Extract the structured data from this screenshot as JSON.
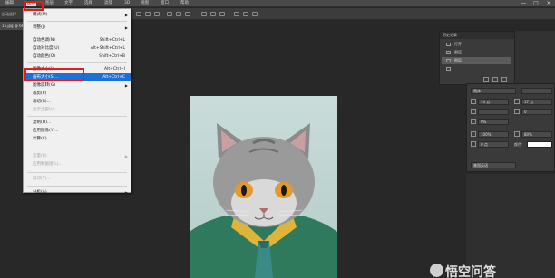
{
  "menubar": {
    "items": [
      "编辑",
      "图像",
      "图层",
      "文字",
      "选择",
      "滤镜",
      "3D",
      "视图",
      "窗口",
      "帮助"
    ],
    "active_index": 1,
    "window_controls": [
      "—",
      "□",
      "×"
    ]
  },
  "options": {
    "label": "自动选择"
  },
  "document_tab": {
    "title": "15.jpg @ 66.7%"
  },
  "image_menu": {
    "items": [
      {
        "label": "模式(M)",
        "shortcut": "",
        "submenu": true,
        "disabled": false,
        "highlight": false
      },
      {
        "label": "调整(J)",
        "shortcut": "",
        "submenu": true,
        "disabled": false,
        "highlight": false
      },
      {
        "label": "自动色调(N)",
        "shortcut": "Shift+Ctrl+L",
        "submenu": false,
        "disabled": false,
        "highlight": false
      },
      {
        "label": "自动对比度(U)",
        "shortcut": "Alt+Shift+Ctrl+L",
        "submenu": false,
        "disabled": false,
        "highlight": false
      },
      {
        "label": "自动颜色(O)",
        "shortcut": "Shift+Ctrl+B",
        "submenu": false,
        "disabled": false,
        "highlight": false
      },
      {
        "label": "图像大小(I)...",
        "shortcut": "Alt+Ctrl+I",
        "submenu": false,
        "disabled": false,
        "highlight": false
      },
      {
        "label": "画布大小(S)...",
        "shortcut": "Alt+Ctrl+C",
        "submenu": false,
        "disabled": false,
        "highlight": true
      },
      {
        "label": "图像旋转(G)",
        "shortcut": "",
        "submenu": true,
        "disabled": false,
        "highlight": false
      },
      {
        "label": "裁剪(P)",
        "shortcut": "",
        "submenu": false,
        "disabled": false,
        "highlight": false
      },
      {
        "label": "裁切(R)...",
        "shortcut": "",
        "submenu": false,
        "disabled": false,
        "highlight": false
      },
      {
        "label": "显示全部(V)",
        "shortcut": "",
        "submenu": false,
        "disabled": true,
        "highlight": false
      },
      {
        "label": "复制(D)...",
        "shortcut": "",
        "submenu": false,
        "disabled": false,
        "highlight": false
      },
      {
        "label": "应用图像(Y)...",
        "shortcut": "",
        "submenu": false,
        "disabled": false,
        "highlight": false
      },
      {
        "label": "计算(C)...",
        "shortcut": "",
        "submenu": false,
        "disabled": false,
        "highlight": false
      },
      {
        "label": "变量(B)",
        "shortcut": "",
        "submenu": true,
        "disabled": true,
        "highlight": false
      },
      {
        "label": "应用数据组(L)...",
        "shortcut": "",
        "submenu": false,
        "disabled": true,
        "highlight": false
      },
      {
        "label": "陷印(T)...",
        "shortcut": "",
        "submenu": false,
        "disabled": true,
        "highlight": false
      },
      {
        "label": "分析(A)",
        "shortcut": "",
        "submenu": true,
        "disabled": false,
        "highlight": false
      }
    ]
  },
  "history_panel": {
    "title": "历史记录",
    "rows": [
      {
        "label": "打开",
        "selected": false
      },
      {
        "label": "图层",
        "selected": false
      },
      {
        "label": "图层",
        "selected": true
      },
      {
        "label": "",
        "selected": false
      }
    ]
  },
  "character_panel": {
    "font": "黑体",
    "size": "14 点",
    "leading": "17 点",
    "tracking": "0",
    "scale_pct": "0%",
    "vscale": "100%",
    "hscale": "80%",
    "baseline": "0 点",
    "color_label": "颜色:",
    "language": "美国英语"
  },
  "watermark": {
    "text": "悟空问答"
  },
  "colors": {
    "menu_highlight": "#1f6fd8",
    "annotation_red": "#e21b1b"
  }
}
